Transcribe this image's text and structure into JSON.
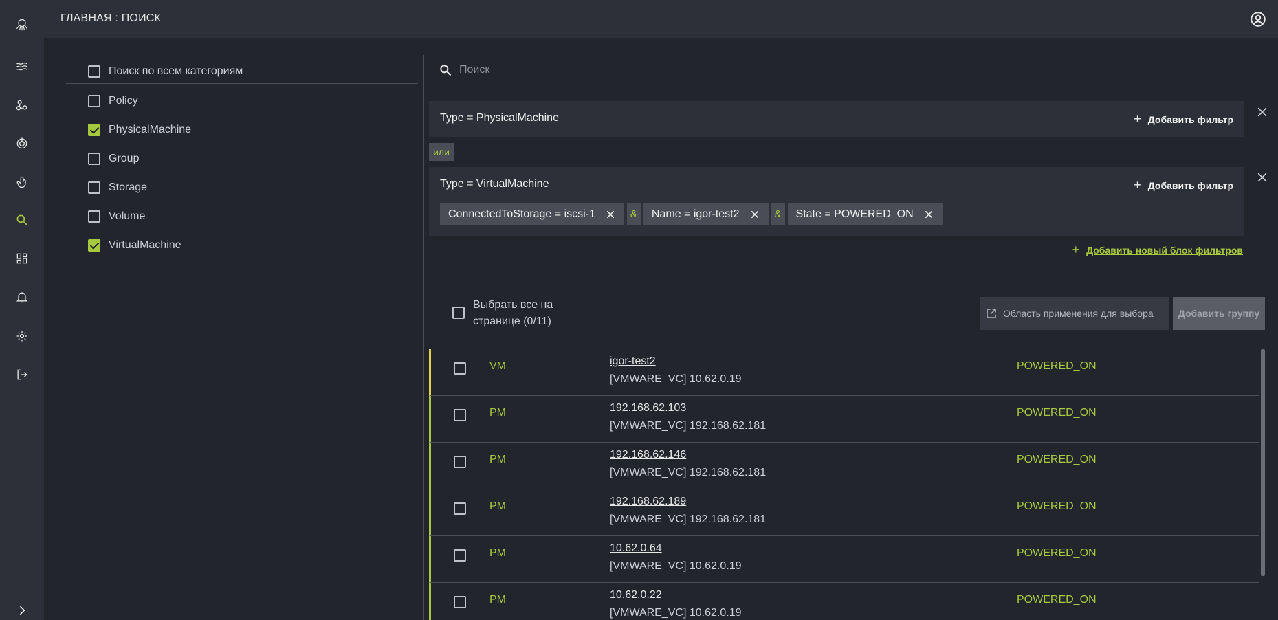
{
  "header": {
    "title": "ГЛАВНАЯ : ПОИСК"
  },
  "nav": {
    "items": [
      {
        "icon": "octopus-logo-icon"
      },
      {
        "icon": "waves-icon"
      },
      {
        "icon": "nodes-icon"
      },
      {
        "icon": "power-target-icon"
      },
      {
        "icon": "touch-icon"
      },
      {
        "icon": "search-icon",
        "active": true
      },
      {
        "icon": "dashboard-icon"
      },
      {
        "icon": "bell-icon"
      },
      {
        "icon": "gear-icon"
      },
      {
        "icon": "logout-icon"
      },
      {
        "icon": "chevron-right-icon"
      }
    ]
  },
  "categories": {
    "all_label": "Поиск по всем категориям",
    "items": [
      {
        "label": "Policy",
        "checked": false
      },
      {
        "label": "PhysicalMachine",
        "checked": true
      },
      {
        "label": "Group",
        "checked": false
      },
      {
        "label": "Storage",
        "checked": false
      },
      {
        "label": "Volume",
        "checked": false
      },
      {
        "label": "VirtualMachine",
        "checked": true
      }
    ]
  },
  "search": {
    "placeholder": "Поиск"
  },
  "filters": {
    "block1": {
      "title": "Type = PhysicalMachine",
      "add_label": "Добавить фильтр"
    },
    "or_label": "или",
    "block2": {
      "title": "Type = VirtualMachine",
      "add_label": "Добавить фильтр",
      "chips": [
        "ConnectedToStorage = iscsi-1",
        "Name = igor-test2",
        "State = POWERED_ON"
      ],
      "amp": "&"
    },
    "add_block_label": "Добавить новый блок фильтров"
  },
  "results": {
    "select_all_line1": "Выбрать все на",
    "select_all_line2": "странице (0/11)",
    "scope_button": "Область применения для выбора",
    "add_group_button": "Добавить группу",
    "rows": [
      {
        "type": "VM",
        "name": "igor-test2",
        "source": "[VMWARE_VC] 10.62.0.19",
        "state": "POWERED_ON"
      },
      {
        "type": "PM",
        "name": "192.168.62.103",
        "source": "[VMWARE_VC] 192.168.62.181",
        "state": "POWERED_ON"
      },
      {
        "type": "PM",
        "name": "192.168.62.146",
        "source": "[VMWARE_VC] 192.168.62.181",
        "state": "POWERED_ON"
      },
      {
        "type": "PM",
        "name": "192.168.62.189",
        "source": "[VMWARE_VC] 192.168.62.181",
        "state": "POWERED_ON"
      },
      {
        "type": "PM",
        "name": "10.62.0.64",
        "source": "[VMWARE_VC] 10.62.0.19",
        "state": "POWERED_ON"
      },
      {
        "type": "PM",
        "name": "10.62.0.22",
        "source": "[VMWARE_VC] 10.62.0.19",
        "state": "POWERED_ON"
      }
    ]
  },
  "colors": {
    "accent": "#a7c93f",
    "highlight": "#e3d34a",
    "panel": "#2d3038",
    "background": "#23252c"
  }
}
